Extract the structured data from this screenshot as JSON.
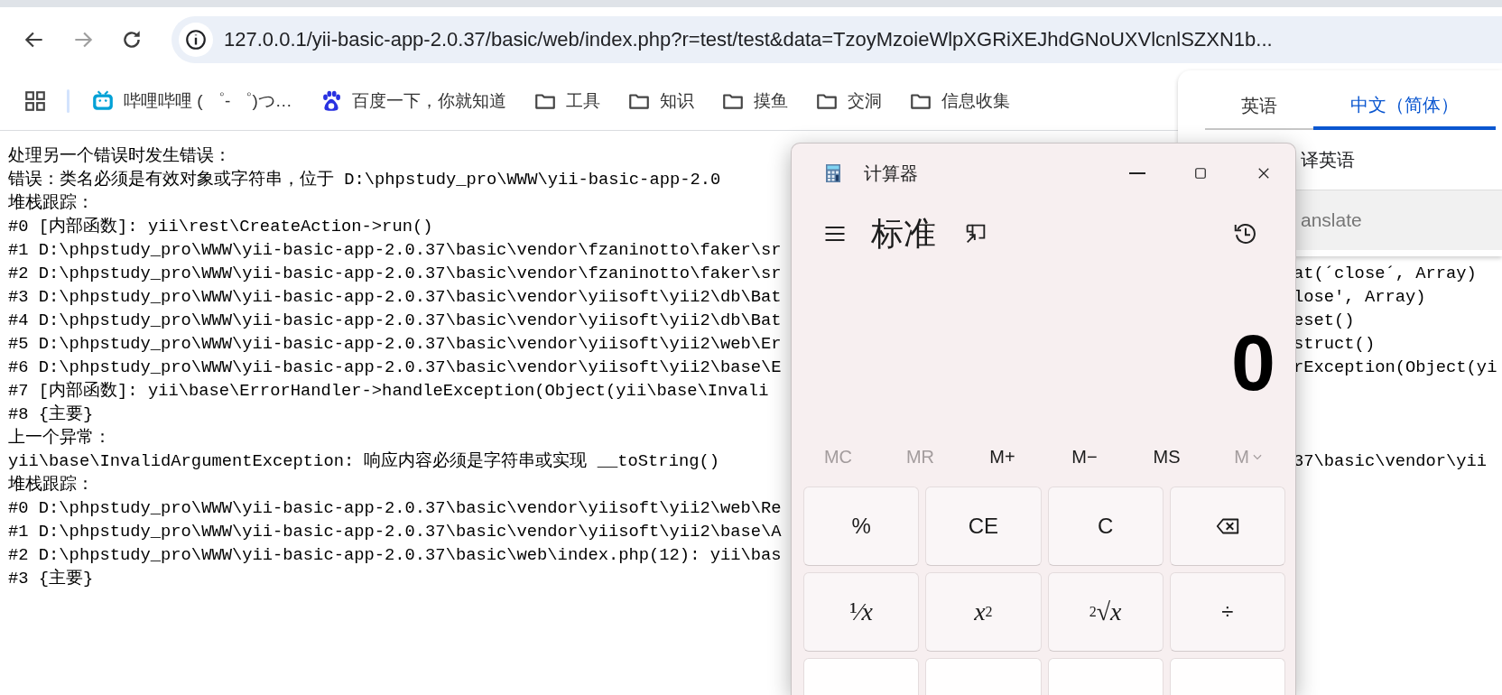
{
  "browser": {
    "nav_buttons": [
      {
        "kind": "back",
        "disabled": false
      },
      {
        "kind": "forward",
        "disabled": true
      },
      {
        "kind": "reload",
        "disabled": false
      }
    ],
    "address": "127.0.0.1/yii-basic-app-2.0.37/basic/web/index.php?r=test/test&data=TzoyMzoieWlpXGRiXEJhdGNoUXVlcnlSZXN1b..."
  },
  "bookmarks": [
    {
      "kind": "bilibili",
      "label": "哔哩哔哩 ( ゜- ゜)つ…"
    },
    {
      "kind": "baidu",
      "label": "百度一下，你就知道"
    },
    {
      "kind": "folder",
      "label": "工具"
    },
    {
      "kind": "folder",
      "label": "知识"
    },
    {
      "kind": "folder",
      "label": "摸鱼"
    },
    {
      "kind": "folder",
      "label": "交洞"
    },
    {
      "kind": "folder",
      "label": "信息收集"
    }
  ],
  "page_lines": [
    {
      "text": "处理另一个错误时发生错误："
    },
    {
      "text": "错误：类名必须是有效对象或字符串，位于 D:\\phpstudy_pro\\WWW\\yii-basic-app-2.0"
    },
    {
      "text": "堆栈跟踪："
    },
    {
      "text": "#0 [内部函数]: yii\\rest\\CreateAction->run()"
    },
    {
      "text": "#1 D:\\phpstudy_pro\\WWW\\yii-basic-app-2.0.37\\basic\\vendor\\fzaninotto\\faker\\sr"
    },
    {
      "text": "#2 D:\\phpstudy_pro\\WWW\\yii-basic-app-2.0.37\\basic\\vendor\\fzaninotto\\faker\\sr",
      "continuation": "at(´close´, Array)"
    },
    {
      "text": "#3 D:\\phpstudy_pro\\WWW\\yii-basic-app-2.0.37\\basic\\vendor\\yiisoft\\yii2\\db\\Bat",
      "continuation": "lose', Array)"
    },
    {
      "text": "#4 D:\\phpstudy_pro\\WWW\\yii-basic-app-2.0.37\\basic\\vendor\\yiisoft\\yii2\\db\\Bat",
      "continuation": "eset()"
    },
    {
      "text": "#5 D:\\phpstudy_pro\\WWW\\yii-basic-app-2.0.37\\basic\\vendor\\yiisoft\\yii2\\web\\Er",
      "continuation": "struct()"
    },
    {
      "text": "#6 D:\\phpstudy_pro\\WWW\\yii-basic-app-2.0.37\\basic\\vendor\\yiisoft\\yii2\\base\\E",
      "continuation": "rException(Object(yi"
    },
    {
      "text": "#7 [内部函数]: yii\\base\\ErrorHandler->handleException(Object(yii\\base\\Invali"
    },
    {
      "text": "#8 {主要}"
    },
    {
      "text": "上一个异常："
    },
    {
      "text": "yii\\base\\InvalidArgumentException: 响应内容必须是字符串或实现 __toString()",
      "continuation": "37\\basic\\vendor\\yii"
    },
    {
      "text": "堆栈跟踪："
    },
    {
      "text": "#0 D:\\phpstudy_pro\\WWW\\yii-basic-app-2.0.37\\basic\\vendor\\yiisoft\\yii2\\web\\Re"
    },
    {
      "text": "#1 D:\\phpstudy_pro\\WWW\\yii-basic-app-2.0.37\\basic\\vendor\\yiisoft\\yii2\\base\\A"
    },
    {
      "text": "#2 D:\\phpstudy_pro\\WWW\\yii-basic-app-2.0.37\\basic\\web\\index.php(12): yii\\bas"
    },
    {
      "text": "#3 {主要}"
    }
  ],
  "translate_popup": {
    "tabs": [
      {
        "label": "英语",
        "selected": false
      },
      {
        "label": "中文（简体）",
        "selected": true
      }
    ],
    "option": "译英语",
    "action": "anslate"
  },
  "calculator": {
    "title": "计算器",
    "mode": "标准",
    "display": "0",
    "memory": [
      {
        "label": "MC",
        "disabled": true,
        "kind": "plain"
      },
      {
        "label": "MR",
        "disabled": true,
        "kind": "plain"
      },
      {
        "label": "M+",
        "disabled": false,
        "kind": "plain"
      },
      {
        "label": "M−",
        "disabled": false,
        "kind": "plain"
      },
      {
        "label": "MS",
        "disabled": false,
        "kind": "plain"
      },
      {
        "label": "M",
        "disabled": true,
        "kind": "menu"
      }
    ],
    "keys": [
      {
        "kind": "function",
        "label": "%"
      },
      {
        "kind": "function",
        "label": "CE"
      },
      {
        "kind": "function",
        "label": "C"
      },
      {
        "kind": "backspace"
      },
      {
        "kind": "math",
        "label": "¹⁄*x*"
      },
      {
        "kind": "math",
        "label": "*x*$^{2}$"
      },
      {
        "kind": "math",
        "label": "$^{2}$√*x*"
      },
      {
        "kind": "function",
        "label": "÷"
      },
      {
        "kind": "blank"
      },
      {
        "kind": "blank"
      },
      {
        "kind": "blank"
      },
      {
        "kind": "blank"
      }
    ]
  }
}
